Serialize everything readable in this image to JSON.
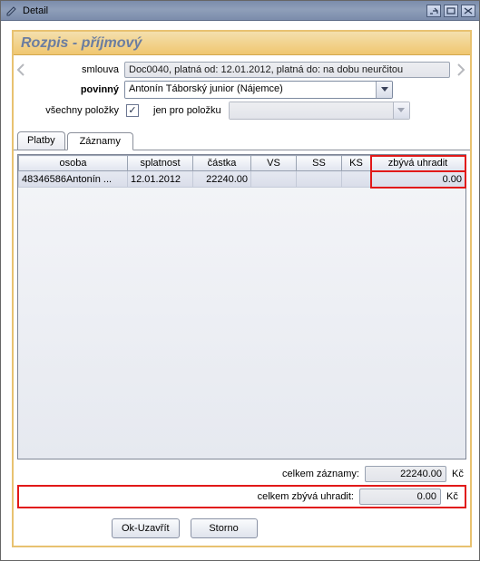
{
  "window": {
    "title": "Detail"
  },
  "header": {
    "title": "Rozpis - příjmový"
  },
  "form": {
    "smlouva_label": "smlouva",
    "smlouva_value": "Doc0040, platná od: 12.01.2012, platná do: na dobu neurčitou",
    "povinny_label": "povinný",
    "povinny_value": "Antonín Táborský junior (Nájemce)",
    "vsechny_label": "všechny položky",
    "vsechny_checked": "✓",
    "jenpro_label": "jen pro položku",
    "jenpro_value": ""
  },
  "tabs": {
    "0": {
      "label": "Platby"
    },
    "1": {
      "label": "Záznamy"
    }
  },
  "table": {
    "headers": {
      "0": "osoba",
      "1": "splatnost",
      "2": "částka",
      "3": "VS",
      "4": "SS",
      "5": "KS",
      "6": "zbývá uhradit"
    },
    "rows": {
      "0": {
        "osoba": "48346586Antonín ...",
        "splatnost": "12.01.2012",
        "castka": "22240.00",
        "vs": "",
        "ss": "",
        "ks": "",
        "zbyva": "0.00"
      }
    }
  },
  "totals": {
    "zaznamy_label": "celkem záznamy:",
    "zaznamy_value": "22240.00",
    "zbyva_label": "celkem zbývá uhradit:",
    "zbyva_value": "0.00",
    "unit": "Kč"
  },
  "buttons": {
    "ok": "Ok-Uzavřít",
    "storno": "Storno"
  },
  "chart_data": {
    "type": "table",
    "columns": [
      "osoba",
      "splatnost",
      "částka",
      "VS",
      "SS",
      "KS",
      "zbývá uhradit"
    ],
    "rows": [
      [
        "48346586Antonín ...",
        "12.01.2012",
        22240.0,
        "",
        "",
        "",
        0.0
      ]
    ],
    "totals": {
      "celkem záznamy": 22240.0,
      "celkem zbývá uhradit": 0.0,
      "unit": "Kč"
    }
  }
}
